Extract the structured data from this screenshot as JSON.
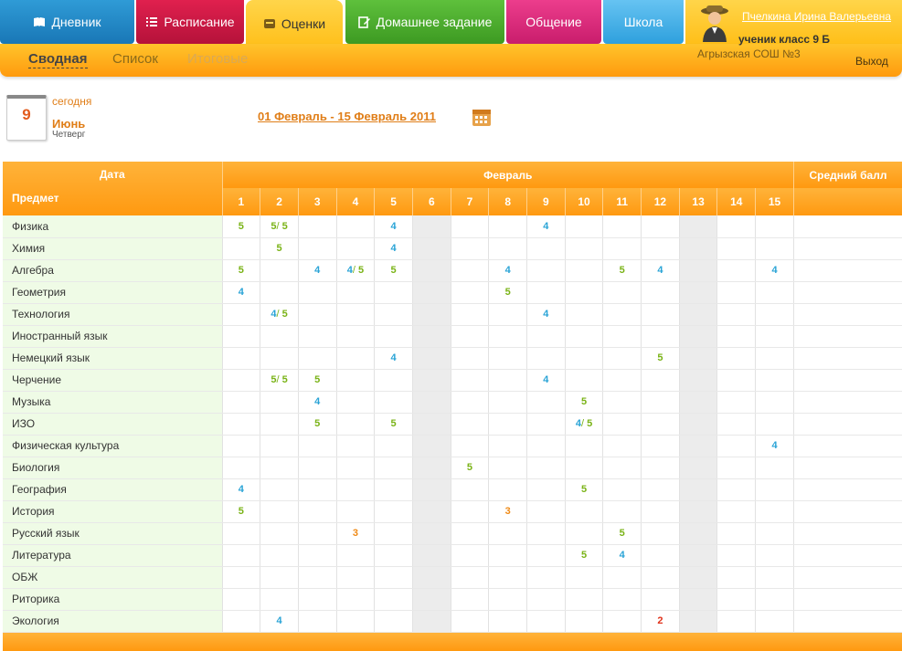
{
  "nav": {
    "tabs": [
      {
        "label": "Дневник",
        "icon": "book-icon"
      },
      {
        "label": "Расписание",
        "icon": "list-icon"
      },
      {
        "label": "Оценки",
        "icon": "grades-icon"
      },
      {
        "label": "Домашнее задание",
        "icon": "edit-icon"
      },
      {
        "label": "Общение",
        "icon": ""
      },
      {
        "label": "Школа",
        "icon": ""
      }
    ],
    "active_tab": "Оценки"
  },
  "subtabs": {
    "svodnaya": "Сводная",
    "spisok": "Список",
    "itogovye": "Итоговые",
    "active": "Сводная"
  },
  "user": {
    "name": "Пчелкина Ирина Валерьевна",
    "class": "ученик класс 9 Б",
    "school": "Агрызская СОШ №3",
    "logout": "Выход"
  },
  "today": {
    "label": "сегодня",
    "day": "9",
    "month": "Июнь",
    "weekday": "Четверг"
  },
  "period": "01 Февраль - 15 Февраль 2011",
  "colors": {
    "accent": "#ff9910",
    "grade5": "#7ab317",
    "grade4": "#28a3d6",
    "grade3": "#ef8a16",
    "grade2": "#e0321b"
  },
  "table": {
    "date_label": "Дата",
    "subject_label": "Предмет",
    "month_label": "Февраль",
    "avg_label": "Средний балл",
    "days": [
      "1",
      "2",
      "3",
      "4",
      "5",
      "6",
      "7",
      "8",
      "9",
      "10",
      "11",
      "12",
      "13",
      "14",
      "15"
    ],
    "weekend_days": [
      "6",
      "13"
    ],
    "rows": [
      {
        "subject": "Физика",
        "marks": {
          "1": "5",
          "2": "5/5",
          "5": "4",
          "9": "4"
        }
      },
      {
        "subject": "Химия",
        "marks": {
          "2": "5",
          "5": "4"
        }
      },
      {
        "subject": "Алгебра",
        "marks": {
          "1": "5",
          "3": "4",
          "4": "4/5",
          "5": "5",
          "8": "4",
          "11": "5",
          "12": "4",
          "15": "4"
        }
      },
      {
        "subject": "Геометрия",
        "marks": {
          "1": "4",
          "8": "5"
        }
      },
      {
        "subject": "Технология",
        "marks": {
          "2": "4/5",
          "9": "4"
        }
      },
      {
        "subject": "Иностранный язык",
        "marks": {}
      },
      {
        "subject": "Немецкий язык",
        "marks": {
          "5": "4",
          "12": "5"
        }
      },
      {
        "subject": "Черчение",
        "marks": {
          "2": "5/5",
          "3": "5",
          "9": "4"
        }
      },
      {
        "subject": "Музыка",
        "marks": {
          "3": "4",
          "10": "5"
        }
      },
      {
        "subject": "ИЗО",
        "marks": {
          "3": "5",
          "5": "5",
          "10": "4/5"
        }
      },
      {
        "subject": "Физическая культура",
        "marks": {
          "15": "4"
        }
      },
      {
        "subject": "Биология",
        "marks": {
          "7": "5"
        }
      },
      {
        "subject": "География",
        "marks": {
          "1": "4",
          "10": "5"
        }
      },
      {
        "subject": "История",
        "marks": {
          "1": "5",
          "8": "3"
        }
      },
      {
        "subject": "Русский язык",
        "marks": {
          "4": "3",
          "11": "5"
        }
      },
      {
        "subject": "Литература",
        "marks": {
          "10": "5",
          "11": "4"
        }
      },
      {
        "subject": "ОБЖ",
        "marks": {}
      },
      {
        "subject": "Риторика",
        "marks": {}
      },
      {
        "subject": "Экология",
        "marks": {
          "2": "4",
          "12": "2"
        }
      }
    ]
  }
}
